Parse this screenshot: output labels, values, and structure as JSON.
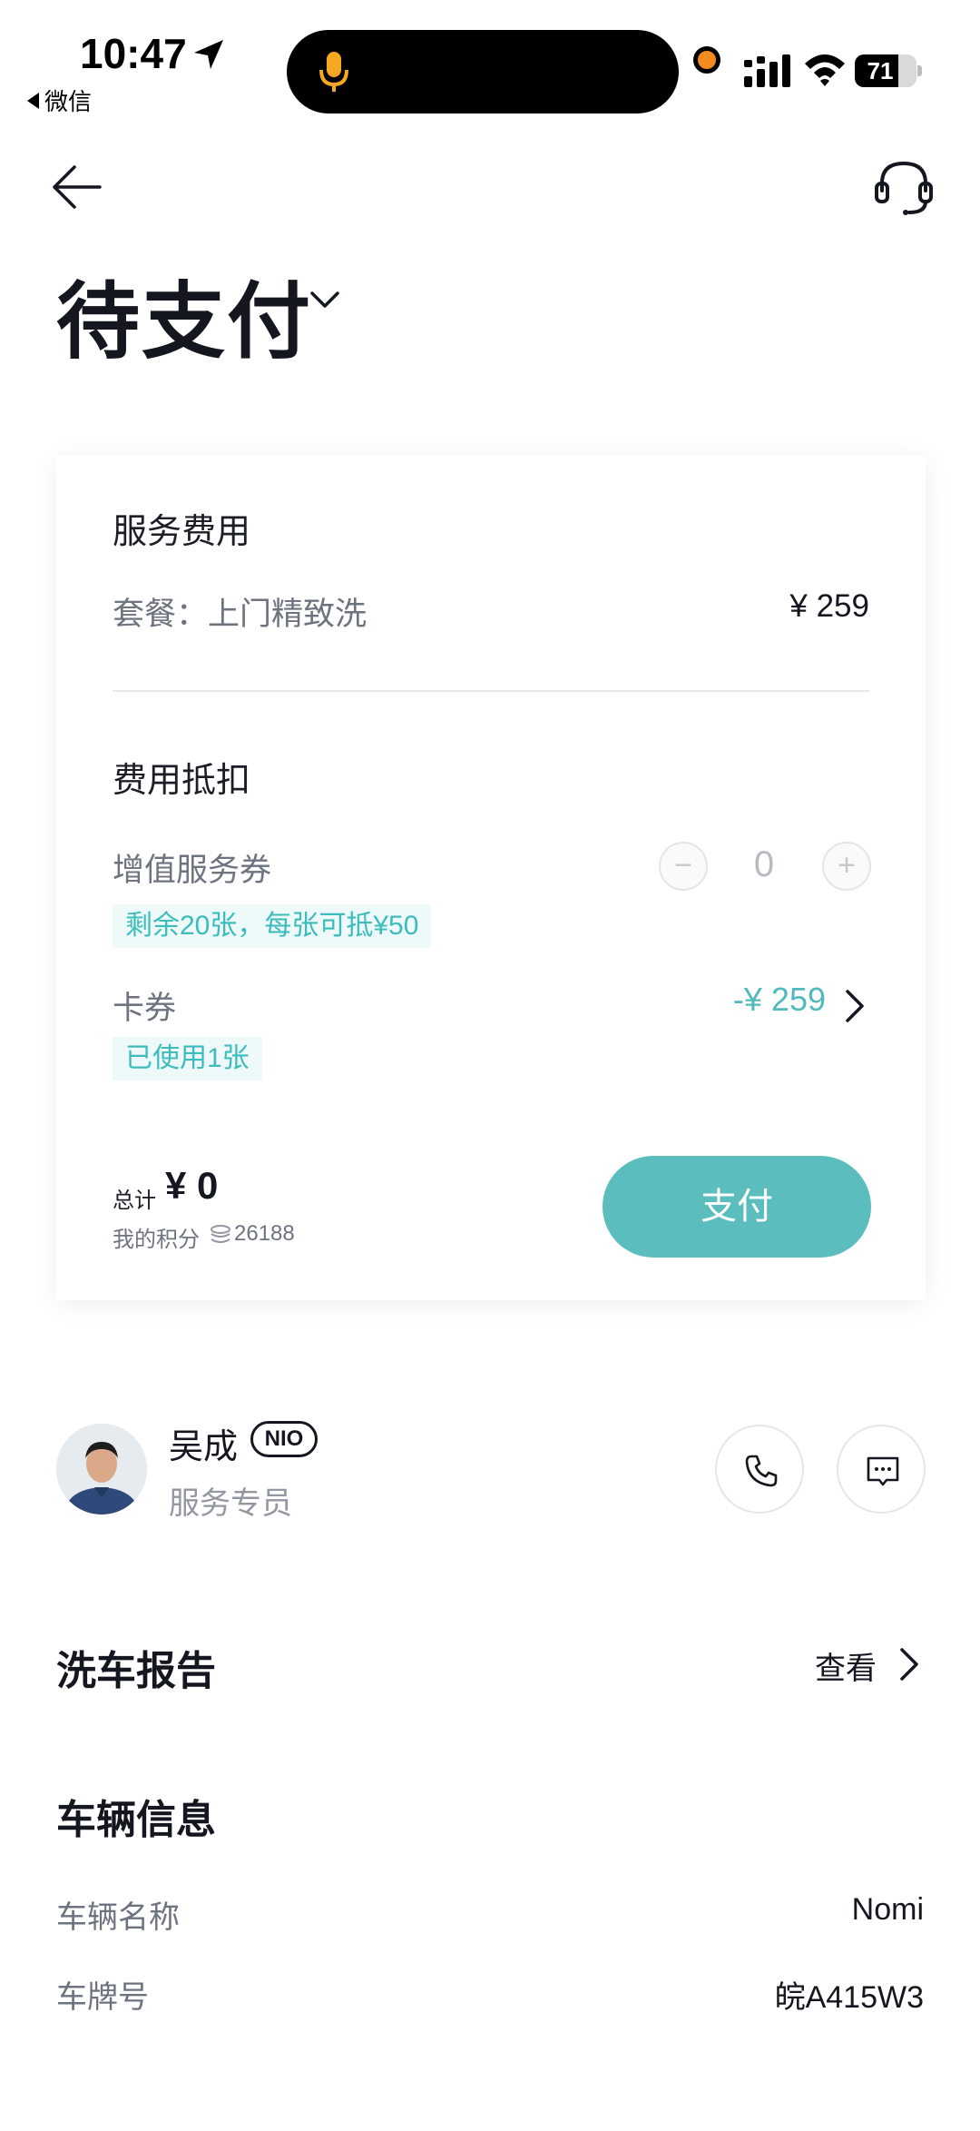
{
  "status_bar": {
    "time": "10:47",
    "back_app": "微信",
    "battery_level": "71",
    "battery_fraction": 0.71,
    "accent_mic_color": "#f5a623",
    "recording_dot_color": "#f28c1c"
  },
  "header": {
    "title": "待支付"
  },
  "card": {
    "service_title": "服务费用",
    "package_label": "套餐：上门精致洗",
    "package_price": "¥ 259",
    "deduction_title": "费用抵扣",
    "voucher_label": "增值服务券",
    "voucher_minus": "−",
    "voucher_count": "0",
    "voucher_plus": "+",
    "voucher_tag": "剩余20张，每张可抵¥50",
    "coupon_label": "卡券",
    "coupon_amount": "-¥ 259",
    "coupon_tag": "已使用1张",
    "total_label": "总计",
    "total_value": "¥ 0",
    "points_label": "我的积分",
    "points_value": "26188",
    "pay_label": "支付",
    "accent_color": "#5bbdbd"
  },
  "staff": {
    "name": "吴成",
    "badge": "NIO",
    "role": "服务专员"
  },
  "report": {
    "title": "洗车报告",
    "view_label": "查看"
  },
  "vehicle": {
    "title": "车辆信息",
    "name_label": "车辆名称",
    "name_value": "Nomi",
    "plate_label": "车牌号",
    "plate_value": "皖A415W3"
  }
}
